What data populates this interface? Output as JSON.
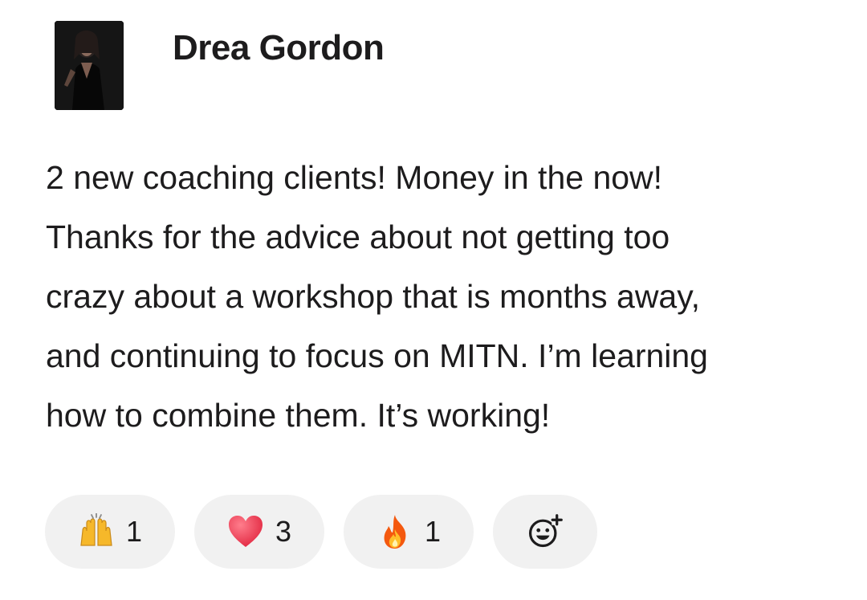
{
  "post": {
    "author": "Drea Gordon",
    "message": "2 new coaching clients! Money in the now!\nThanks for the advice about not getting too\ncrazy about a workshop that is months away,\nand continuing to focus on MITN. I’m learning\nhow to combine them. It’s working!"
  },
  "reactions": [
    {
      "icon": "raising-hands-icon",
      "count": "1"
    },
    {
      "icon": "red-heart-icon",
      "count": "3"
    },
    {
      "icon": "fire-icon",
      "count": "1"
    }
  ],
  "add_reaction": {
    "icon": "add-reaction-icon"
  },
  "colors": {
    "pill_background": "#f1f1f1",
    "text": "#1d1c1d",
    "heart": "#e8364a",
    "fire": "#f4590f",
    "hands": "#f6b82a"
  }
}
